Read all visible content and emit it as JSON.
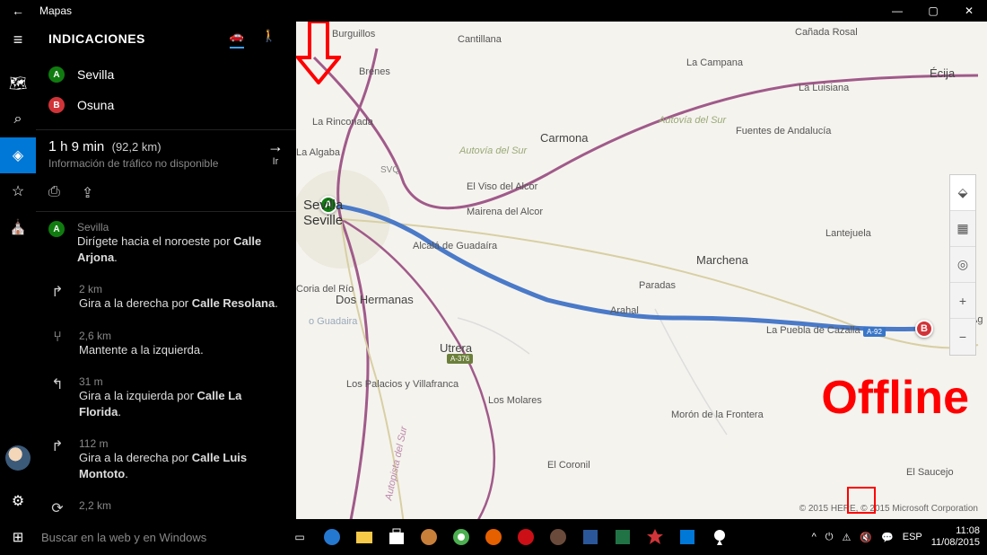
{
  "titlebar": {
    "app_name": "Mapas"
  },
  "panel": {
    "heading": "INDICACIONES",
    "waypoints": {
      "a": "Sevilla",
      "b": "Osuna"
    },
    "summary": {
      "time_h": "1",
      "time_h_unit": "h",
      "time_m": "9",
      "time_m_unit": "min",
      "distance": "(92,2 km)",
      "traffic": "Información de tráfico no disponible",
      "go_label": "Ir"
    },
    "steps": [
      {
        "icon": "A",
        "dist": "Sevilla",
        "text_pre": "Dirígete hacia el noroeste por ",
        "text_bold": "Calle Arjona",
        "text_post": "."
      },
      {
        "icon": "↱",
        "dist": "2 km",
        "text_pre": "Gira a la derecha por ",
        "text_bold": "Calle Resolana",
        "text_post": "."
      },
      {
        "icon": "⑂",
        "dist": "2,6 km",
        "text_pre": "Mantente a la izquierda.",
        "text_bold": "",
        "text_post": ""
      },
      {
        "icon": "↰",
        "dist": "31 m",
        "text_pre": "Gira a la izquierda por ",
        "text_bold": "Calle La Florida",
        "text_post": "."
      },
      {
        "icon": "↱",
        "dist": "112 m",
        "text_pre": "Gira a la derecha por ",
        "text_bold": "Calle Luis Montoto",
        "text_post": "."
      },
      {
        "icon": "⟳",
        "dist": "2,2 km",
        "text_pre": "",
        "text_bold": "",
        "text_post": ""
      }
    ]
  },
  "map": {
    "places": {
      "burguillos": "Burguillos",
      "brenes": "Brenes",
      "la_rinconada": "La Rinconada",
      "la_algaba": "La Algaba",
      "sevilla": "Sevilla",
      "seville": "Seville",
      "svq": "SVQ",
      "carmona": "Carmona",
      "cantillana": "Cantillana",
      "la_campana": "La Campana",
      "canada_rosal": "Cañada Rosal",
      "ecija": "Écija",
      "la_luisiana": "La Luisiana",
      "fuentes": "Fuentes de Andalucía",
      "lantejuela": "Lantejuela",
      "marchena": "Marchena",
      "paradas": "Paradas",
      "arahal": "Arahal",
      "la_puebla": "La Puebla de Cazalla",
      "mairena": "Mairena del Alcor",
      "alcala": "Alcalá de Guadaíra",
      "dos_hermanas": "Dos Hermanas",
      "el_viso": "El Viso del Alcor",
      "coria": "Coria del Río",
      "los_palacios": "Los Palacios y Villafranca",
      "los_molares": "Los Molares",
      "el_coronil": "El Coronil",
      "moron": "Morón de la Frontera",
      "utrera": "Utrera",
      "el_saucejo": "El Saucejo",
      "guadaira": "o Guadaira",
      "autovia": "Autovía del Sur",
      "autopista": "Autopista del Sur",
      "ag": "Ag"
    },
    "roads": {
      "a376": "A-376",
      "a92": "A-92"
    },
    "attribution": "© 2015 HERE, © 2015 Microsoft Corporation"
  },
  "annotations": {
    "offline": "Offline"
  },
  "taskbar": {
    "search_placeholder": "Buscar en la web y en Windows",
    "lang": "ESP",
    "time": "11:08",
    "date": "11/08/2015"
  }
}
